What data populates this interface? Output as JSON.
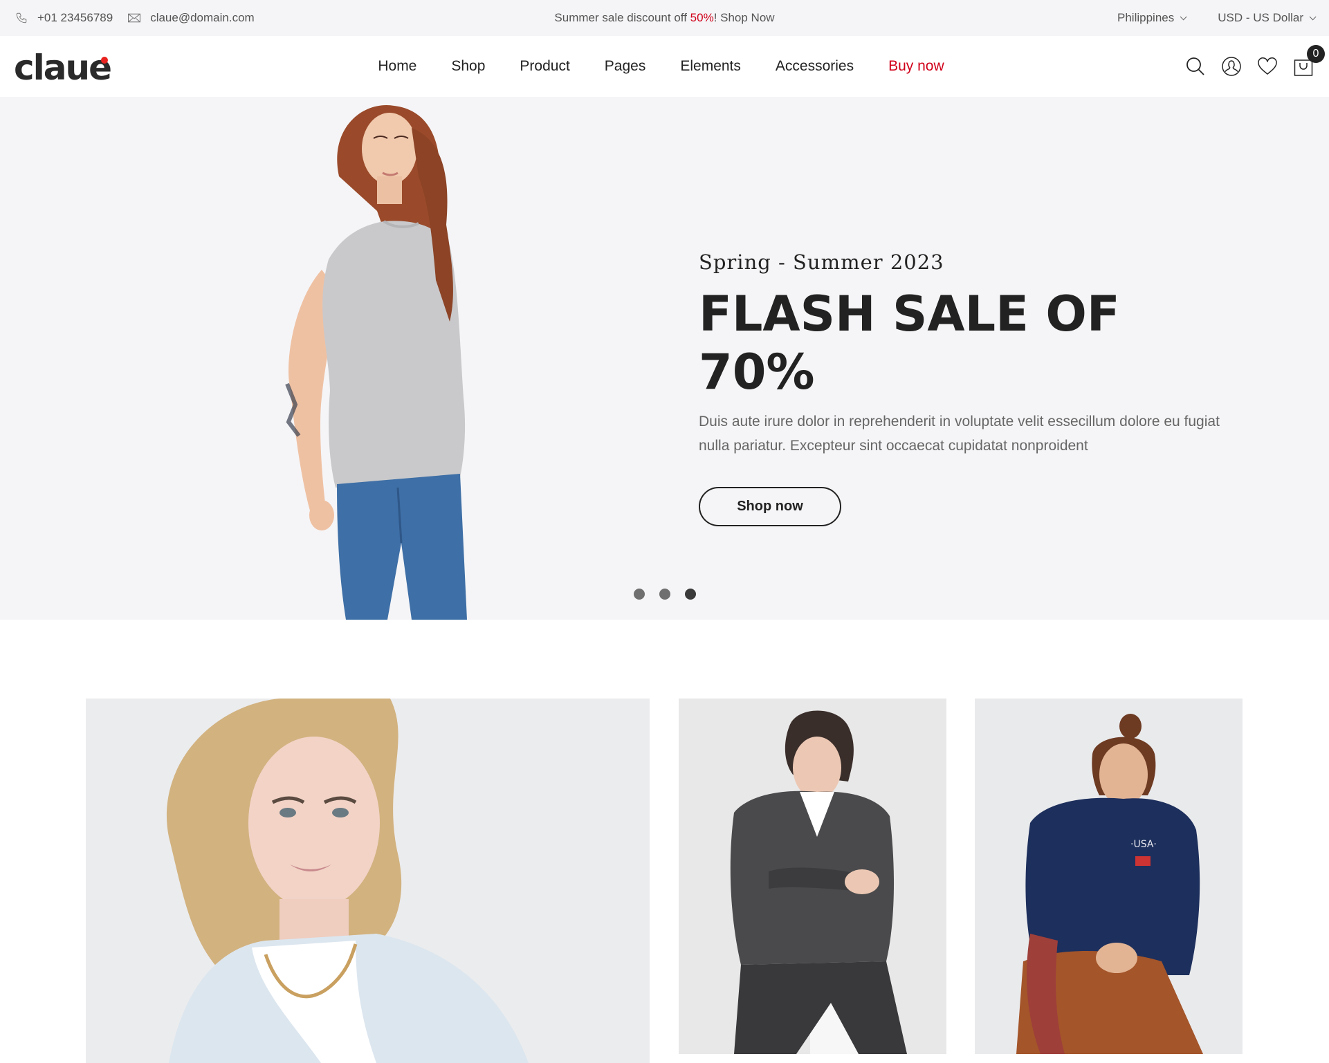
{
  "topbar": {
    "phone": "+01 23456789",
    "phone_icon": "phone-icon",
    "email": "claue@domain.com",
    "email_icon": "mail-icon",
    "promo_prefix": "Summer sale discount off ",
    "promo_highlight": "50%",
    "promo_suffix": "! Shop Now",
    "country": "Philippines",
    "currency": "USD - US Dollar"
  },
  "header": {
    "logo": "claue",
    "nav": [
      {
        "label": "Home"
      },
      {
        "label": "Shop"
      },
      {
        "label": "Product"
      },
      {
        "label": "Pages"
      },
      {
        "label": "Elements"
      },
      {
        "label": "Accessories"
      },
      {
        "label": "Buy now",
        "accent": true
      }
    ],
    "icons": [
      "search-icon",
      "user-icon",
      "heart-icon",
      "cart-icon"
    ],
    "cart_count": "0"
  },
  "hero": {
    "subtitle": "Spring - Summer 2023",
    "title": "FLASH SALE OF 70%",
    "description": "Duis aute irure dolor in reprehenderit in voluptate velit essecillum dolore eu fugiat nulla pariatur. Excepteur sint occaecat cupidatat nonproident",
    "button": "Shop now",
    "slides": 3,
    "active_slide": 3
  },
  "banners": [
    {
      "image": "woman-blonde-light-blue-jacket"
    },
    {
      "image": "man-denim-jacket"
    },
    {
      "image": "woman-navy-usa-sweatshirt"
    }
  ],
  "colors": {
    "accent": "#d0021b",
    "logo_dot": "#e8231f",
    "text": "#222222",
    "hero_bg": "#f5f5f7"
  }
}
